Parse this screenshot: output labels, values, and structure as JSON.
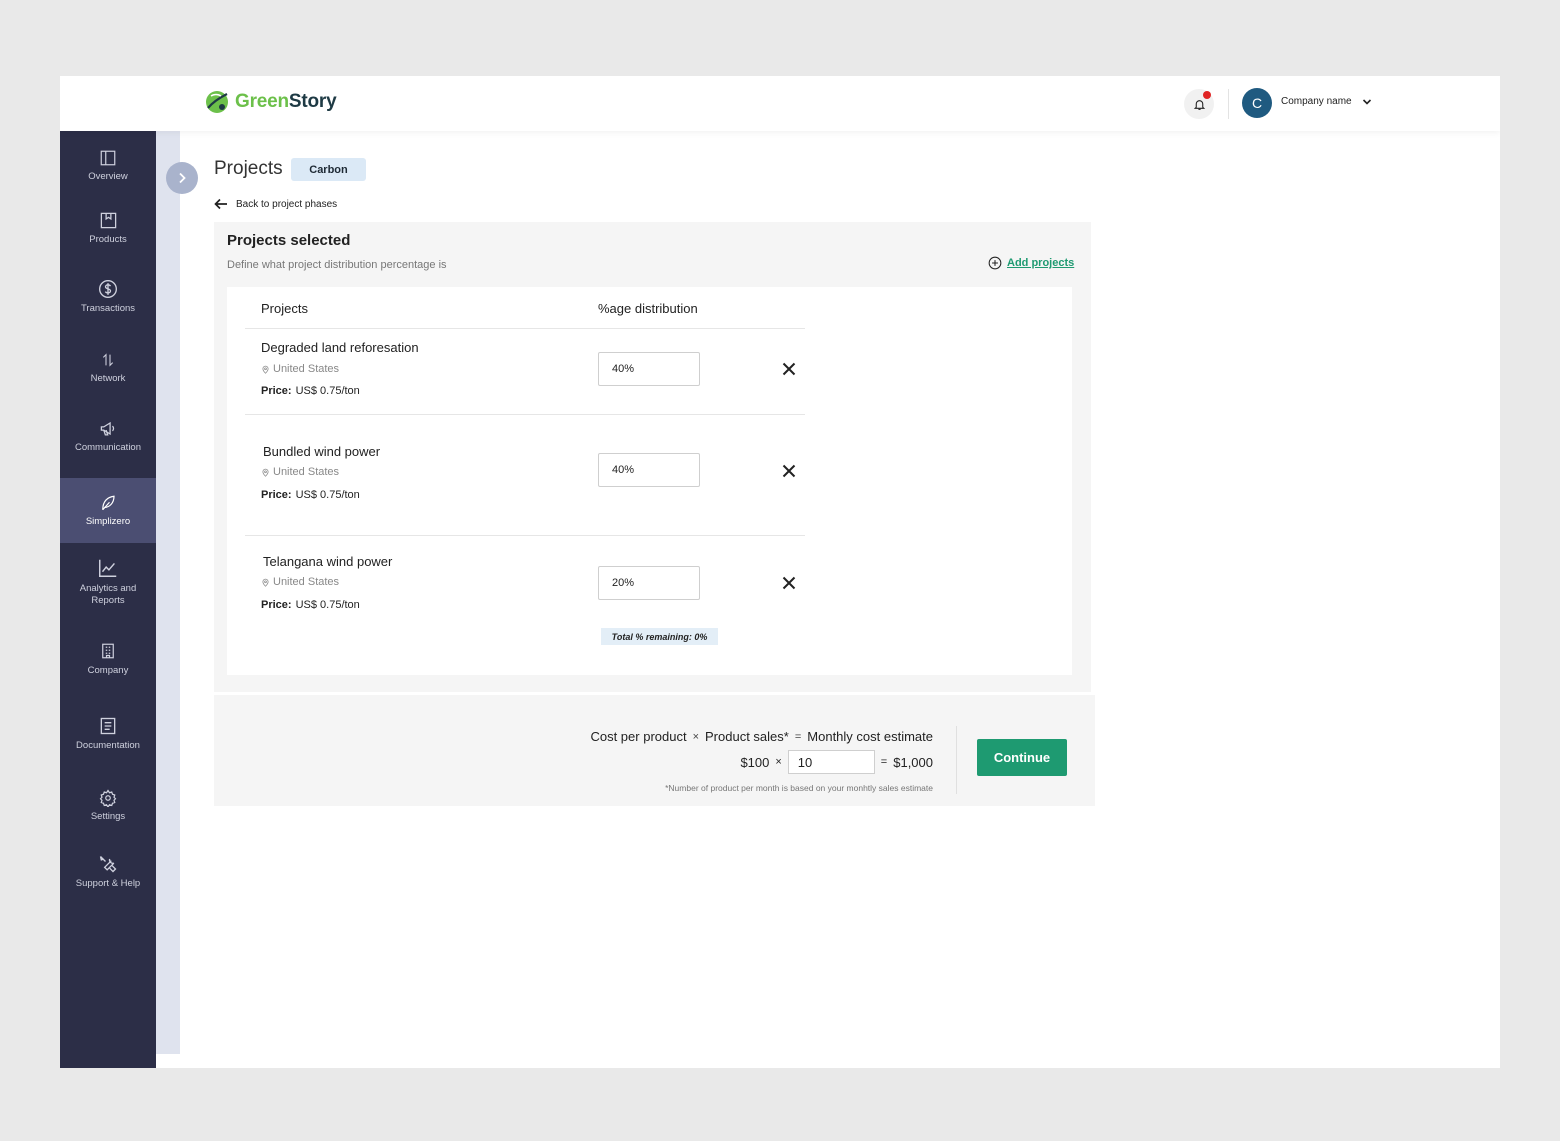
{
  "header": {
    "logo_part1": "Green",
    "logo_part2": "Story",
    "company_name": "Company name"
  },
  "sidebar": {
    "items": [
      {
        "label": "Overview",
        "icon": "layout-panel-icon"
      },
      {
        "label": "Products",
        "icon": "bookmark-box-icon"
      },
      {
        "label": "Transactions",
        "icon": "dollar-circle-icon"
      },
      {
        "label": "Network",
        "icon": "arrows-up-down-icon"
      },
      {
        "label": "Communication",
        "icon": "megaphone-icon"
      },
      {
        "label": "Simplizero",
        "icon": "leaf-icon",
        "active": true
      },
      {
        "label": "Analytics and Reports",
        "icon": "line-chart-icon"
      },
      {
        "label": "Company",
        "icon": "building-icon"
      },
      {
        "label": "Documentation",
        "icon": "document-icon"
      },
      {
        "label": "Settings",
        "icon": "gear-icon"
      },
      {
        "label": "Support & Help",
        "icon": "tools-icon"
      }
    ]
  },
  "page": {
    "title": "Projects",
    "badge": "Carbon",
    "back_label": "Back to project phases"
  },
  "card": {
    "title": "Projects selected",
    "subtitle": "Define what project distribution percentage is",
    "add_projects": "Add projects",
    "col_projects": "Projects",
    "col_distribution": "%age distribution",
    "price_label": "Price:",
    "rows": [
      {
        "name": "Degraded land reforesation",
        "location": "United States",
        "price": "US$ 0.75/ton",
        "percent": "40%"
      },
      {
        "name": "Bundled wind power",
        "location": "United States",
        "price": "US$ 0.75/ton",
        "percent": "40%"
      },
      {
        "name": "Telangana wind power",
        "location": "United States",
        "price": "US$ 0.75/ton",
        "percent": "20%"
      }
    ],
    "remaining": "Total % remaining: 0%"
  },
  "cost": {
    "label_cost": "Cost per product",
    "op_times": "×",
    "label_sales": "Product sales*",
    "op_equals": "=",
    "label_estimate": "Monthly cost estimate",
    "cost_value": "$100",
    "quantity": "10",
    "estimate_value": "$1,000",
    "footnote": "*Number of product per month is based on your monhtly sales estimate",
    "continue_label": "Continue"
  },
  "colors": {
    "sidebar_bg": "#2c2e47",
    "sidebar_active": "#4b4e72",
    "accent_green": "#1e9a71",
    "avatar_blue": "#1f5a80",
    "notification_red": "#e02424"
  }
}
